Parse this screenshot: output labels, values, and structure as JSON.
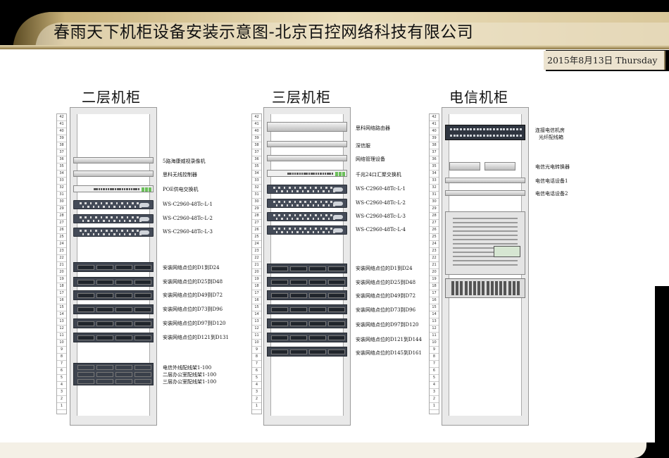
{
  "header": {
    "title": "春雨天下机柜设备安装示意图-北京百控网络科技有限公司",
    "date": "2015年8月13日 Thursday"
  },
  "racks": [
    {
      "title": "二层机柜",
      "labels": [
        "5路海康威视录像机",
        "思科无线控制器",
        "POE供电交换机",
        "WS-C2960-48Tc-L-1",
        "WS-C2960-48Tc-L-2",
        "WS-C2960-48Tc-L-3",
        "安装网络点位的D1到D24",
        "安装网络点位的D25到D48",
        "安装网络点位的D49到D72",
        "安装网络点位的D73到D96",
        "安装网络点位的D97到D120",
        "安装网络点位的D121到D131",
        "电信外线配线架1-100",
        "二层办公室配线架1-100",
        "三层办公室配线架1-100"
      ]
    },
    {
      "title": "三层机柜",
      "labels": [
        "思科网络路由器",
        "深信服",
        "网络管理设备",
        "千兆24口汇聚交换机",
        "WS-C2960-48Tc-L-1",
        "WS-C2960-48Tc-L-2",
        "WS-C2960-48Tc-L-3",
        "WS-C2960-48Tc-L-4",
        "安装网络点位的D1到D24",
        "安装网络点位的D25到D48",
        "安装网络点位的D49到D72",
        "安装网络点位的D73到D96",
        "安装网络点位的D97到D120",
        "安装网络点位的D121到D144",
        "安装网络点位的D145到D161"
      ]
    },
    {
      "title": "电信机柜",
      "labels": [
        "连接电信机房",
        "光纤配线箱",
        "电信光电转换器",
        "电信电话设备1",
        "电信电话设备2"
      ]
    }
  ],
  "colors": {
    "header_gold": "#b59a55",
    "header_dark": "#3a2f18",
    "switch": "#444b58",
    "patch_panel": "#3f4550"
  }
}
